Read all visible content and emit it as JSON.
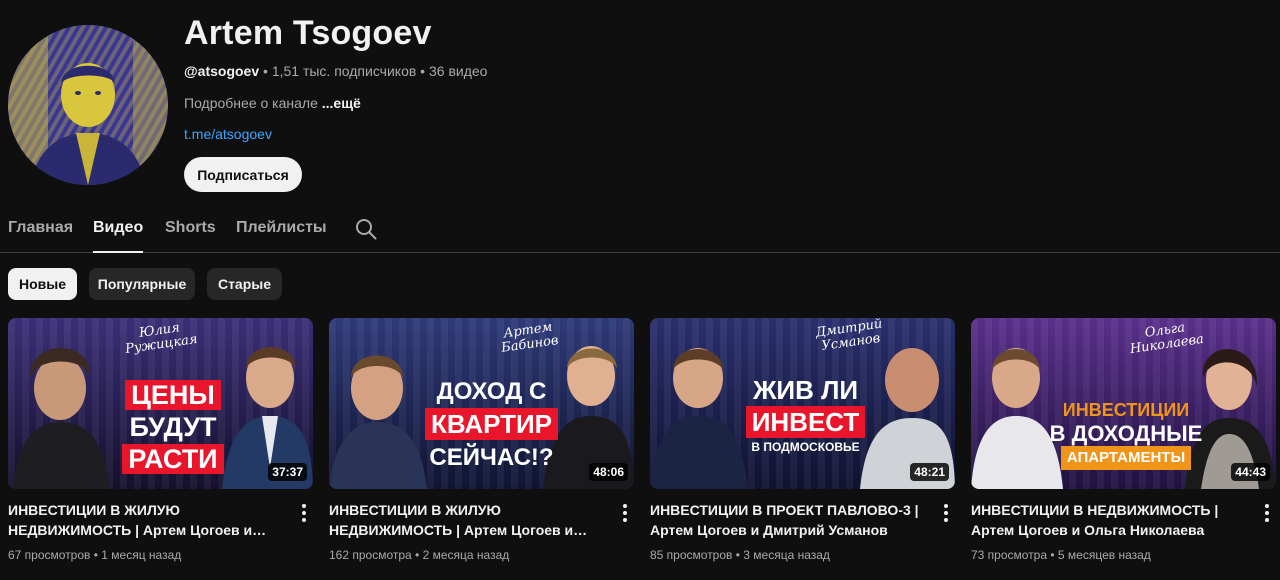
{
  "channel": {
    "name": "Artem Tsogoev",
    "handle": "@atsogoev",
    "subscribers": "1,51 тыс. подписчиков",
    "video_count": "36 видео",
    "separator": " • ",
    "about": "Подробнее о канале",
    "about_more": "...ещё",
    "link": "t.me/atsogoev",
    "subscribe_label": "Подписаться"
  },
  "tabs": [
    {
      "label": "Главная",
      "active": false
    },
    {
      "label": "Видео",
      "active": true
    },
    {
      "label": "Shorts",
      "active": false
    },
    {
      "label": "Плейлисты",
      "active": false
    }
  ],
  "chips": [
    {
      "label": "Новые",
      "active": true
    },
    {
      "label": "Популярные",
      "active": false
    },
    {
      "label": "Старые",
      "active": false
    }
  ],
  "colors": {
    "background": "#0f0f0f",
    "link": "#3ea6ff",
    "chip": "#272727",
    "thumb_red": "#e8152b",
    "thumb_orange": "#f0941a",
    "thumb_bg": "#2b2358"
  },
  "videos": [
    {
      "title": "ИНВЕСТИЦИИ В ЖИЛУЮ НЕДВИЖИМОСТЬ | Артем Цогоев и Юлия Ружицкая",
      "views": "67 просмотров",
      "age": "1 месяц назад",
      "duration": "37:37",
      "thumb_signature": [
        "Юлия",
        "Ружицкая"
      ],
      "thumb_lines": [
        "ЦЕНЫ",
        "БУДУТ",
        "РАСТИ"
      ]
    },
    {
      "title": "ИНВЕСТИЦИИ В ЖИЛУЮ НЕДВИЖИМОСТЬ | Артем Цогоев и Артем Бабинов",
      "views": "162 просмотра",
      "age": "2 месяца назад",
      "duration": "48:06",
      "thumb_signature": [
        "Артем",
        "Бабинов"
      ],
      "thumb_lines": [
        "ДОХОД С",
        "КВАРТИР",
        "СЕЙЧАС!?"
      ]
    },
    {
      "title": "ИНВЕСТИЦИИ В ПРОЕКТ ПАВЛОВО-3 | Артем Цогоев и Дмитрий Усманов",
      "views": "85 просмотров",
      "age": "3 месяца назад",
      "duration": "48:21",
      "thumb_signature": [
        "Дмитрий",
        "Усманов"
      ],
      "thumb_lines": [
        "ЖИВ ЛИ",
        "ИНВЕСТ",
        "В ПОДМОСКОВЬЕ"
      ]
    },
    {
      "title": "ИНВЕСТИЦИИ В НЕДВИЖИМОСТЬ | Артем Цогоев и Ольга Николаева",
      "views": "73 просмотра",
      "age": "5 месяцев назад",
      "duration": "44:43",
      "thumb_signature": [
        "Ольга",
        "Николаева"
      ],
      "thumb_lines": [
        "ИНВЕСТИЦИИ",
        "В ДОХОДНЫЕ",
        "АПАРТАМЕНТЫ"
      ]
    }
  ]
}
